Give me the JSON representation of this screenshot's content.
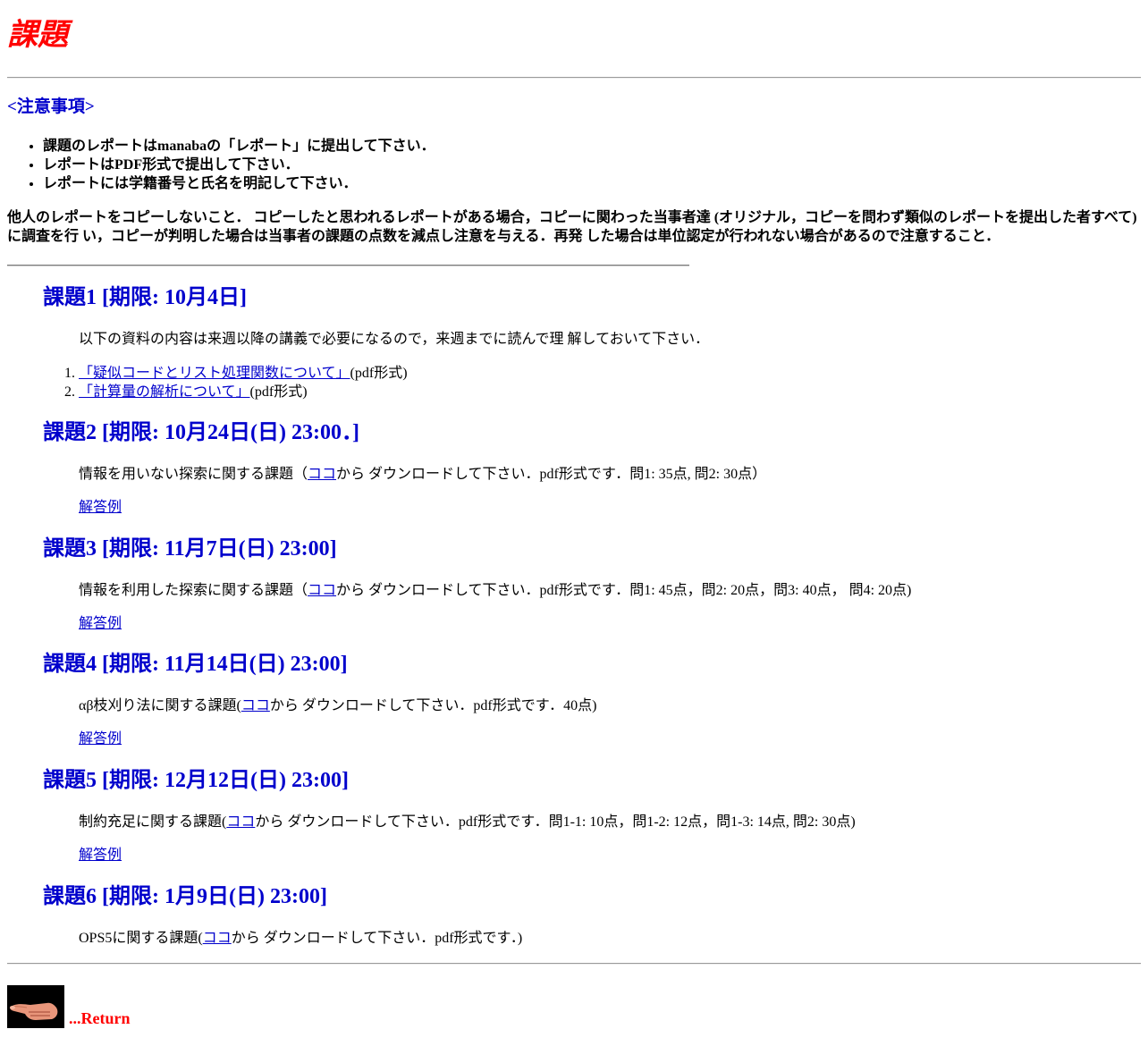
{
  "page": {
    "title": "課題",
    "notes_heading": "<注意事項>",
    "notes": [
      "課題のレポートはmanabaの「レポート」に提出して下さい．",
      "レポートはPDF形式で提出して下さい．",
      "レポートには学籍番号と氏名を明記して下さい．"
    ],
    "warning_line1": "他人のレポートをコピーしないこと． コピーしたと思われるレポートがある場合，コピーに関わった当事者達 (オリジナル，コピーを問わず類似のレポートを提出した者すべて)",
    "warning_line2": "に調査を行 い，コピーが判明した場合は当事者の課題の点数を減点し注意を与える．再発 した場合は単位認定が行われない場合があるので注意すること．"
  },
  "assignments": [
    {
      "title": "課題1 [期限: 10月4日]",
      "desc": "以下の資料の内容は来週以降の講義で必要になるので，来週までに読んで理 解しておいて下さい．",
      "materials": [
        {
          "link": "「疑似コードとリスト処理関数について」",
          "suffix": "(pdf形式)"
        },
        {
          "link": "「計算量の解析について」",
          "suffix": "(pdf形式)"
        }
      ]
    },
    {
      "title": "課題2 [期限: 10月24日(日) 23:00．]",
      "desc_before": "情報を用いない探索に関する課題（",
      "link": "ココ",
      "desc_after": "から ダウンロードして下さい．pdf形式です．問1: 35点, 問2: 30点）",
      "answer": "解答例"
    },
    {
      "title": "課題3 [期限: 11月7日(日) 23:00]",
      "desc_before": "情報を利用した探索に関する課題（",
      "link": "ココ",
      "desc_after": "から ダウンロードして下さい．pdf形式です．問1: 45点，問2: 20点，問3: 40点， 問4: 20点)",
      "answer": "解答例"
    },
    {
      "title": "課題4 [期限: 11月14日(日) 23:00]",
      "desc_before": "αβ枝刈り法に関する課題(",
      "link": "ココ",
      "desc_after": "から ダウンロードして下さい．pdf形式です．40点)",
      "answer": "解答例"
    },
    {
      "title": "課題5 [期限: 12月12日(日) 23:00]",
      "desc_before": "制約充足に関する課題(",
      "link": "ココ",
      "desc_after": "から ダウンロードして下さい．pdf形式です．問1-1: 10点，問1-2: 12点，問1-3: 14点, 問2: 30点)",
      "answer": "解答例"
    },
    {
      "title": "課題6 [期限: 1月9日(日) 23:00]",
      "desc_before": "OPS5に関する課題(",
      "link": "ココ",
      "desc_after": "から ダウンロードして下さい．pdf形式です．)"
    }
  ],
  "footer": {
    "return_label": "...Return",
    "icon": "pointing-hand-icon"
  },
  "colors": {
    "title": "#ff0000",
    "heading": "#0000cc",
    "link": "#0000cc",
    "return": "#ff0000"
  }
}
